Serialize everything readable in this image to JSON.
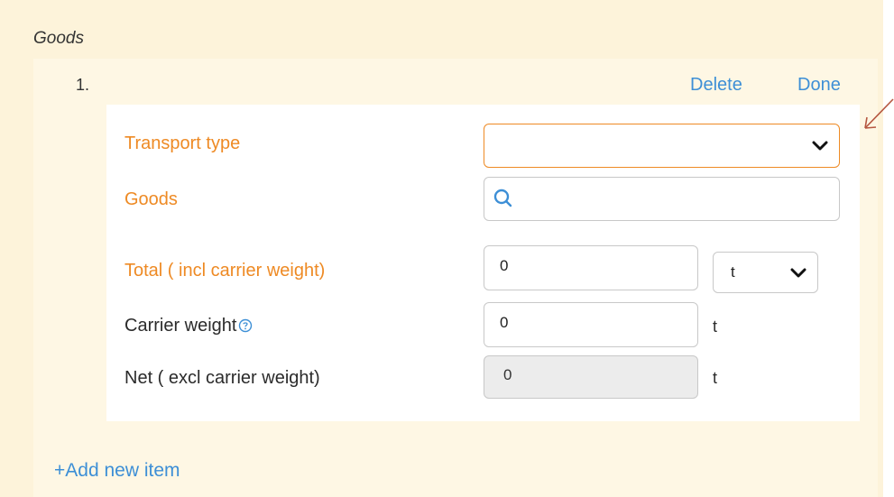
{
  "section": {
    "title": "Goods"
  },
  "item": {
    "number": "1.",
    "delete_label": "Delete",
    "done_label": "Done"
  },
  "form": {
    "transport_type": {
      "label": "Transport type",
      "value": "",
      "required": true
    },
    "goods": {
      "label": "Goods",
      "value": "",
      "required": true,
      "icon": "search-icon"
    },
    "total": {
      "label": "Total ( incl carrier weight)",
      "value": "0",
      "unit": "t",
      "required": true
    },
    "carrier_weight": {
      "label": "Carrier weight",
      "value": "0",
      "unit": "t",
      "icon": "help-icon"
    },
    "net": {
      "label": "Net ( excl carrier weight)",
      "value": "0",
      "unit": "t",
      "readonly": true
    }
  },
  "add_item_label": "+Add new item",
  "colors": {
    "required_label": "#ee8a24",
    "link": "#3d8fd6",
    "panel_bg": "#fdf3da",
    "annotation_arrow": "#b5563f"
  }
}
